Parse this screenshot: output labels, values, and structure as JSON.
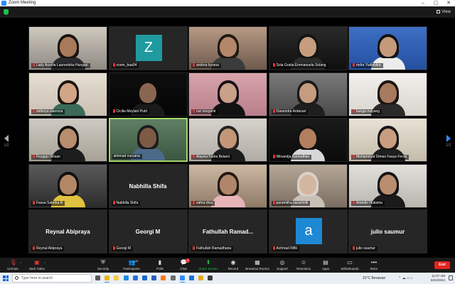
{
  "window": {
    "title": "Zoom Meeting",
    "view_label": "View"
  },
  "pagination": {
    "left": "1/2",
    "right": "1/2"
  },
  "participants": [
    {
      "name": "Lady Aurelia Laurentzka Hungari",
      "type": "video",
      "muted": true,
      "scene": [
        "#cfc9bf",
        "#8f8a82"
      ],
      "skin": "#a97a5a",
      "hair": "#1a1410",
      "shirt": "#2a2a2e"
    },
    {
      "name": "zoom_baa04",
      "type": "avatar",
      "letter": "Z",
      "avatar_color": "#1f9a9e",
      "muted": true
    },
    {
      "name": "andrea kyrana",
      "type": "video",
      "muted": true,
      "scene": [
        "#b79a84",
        "#6e5a4e"
      ],
      "skin": "#b5876a",
      "hair": "#201812",
      "shirt": "#3b3b3b"
    },
    {
      "name": "Sola Gratia Emmanuela Solang",
      "type": "video",
      "muted": true,
      "scene": [
        "#2b2b2b",
        "#0f0f0f"
      ],
      "skin": "#c79c7e",
      "hair": "#141414",
      "shirt": "#2b2b2b"
    },
    {
      "name": "mdra Yudhistira",
      "type": "video",
      "muted": true,
      "scene": [
        "#3d6fc4",
        "#2550a0"
      ],
      "skin": "#c49a7b",
      "hair": "#121212",
      "shirt": "#ececec"
    },
    {
      "name": "zefanya valencia",
      "type": "video",
      "muted": true,
      "scene": [
        "#e7dfd3",
        "#c9bfb2"
      ],
      "skin": "#d1a587",
      "hair": "#1b140f",
      "shirt": "#3b6b58"
    },
    {
      "name": "Cicilia Meylani Putri",
      "type": "video",
      "muted": true,
      "scene": [
        "#0e0e0e",
        "#050505"
      ],
      "skin": "#8a6650",
      "hair": "#0c0c0c",
      "shirt": "#1a1a1a"
    },
    {
      "name": "nur novyanti",
      "type": "video",
      "muted": true,
      "scene": [
        "#d8a4ac",
        "#b87f8a"
      ],
      "skin": "#c9a088",
      "hair": "#161016",
      "shirt": "#121212"
    },
    {
      "name": "Danendra Ardanari",
      "type": "video",
      "muted": true,
      "scene": [
        "#7a7a7a",
        "#4a4a4a"
      ],
      "skin": "#c59c7f",
      "hair": "#1a1a1a",
      "shirt": "#1e1e1e"
    },
    {
      "name": "bunga mayang",
      "type": "video",
      "muted": true,
      "scene": [
        "#f2f0ec",
        "#d9d5cf"
      ],
      "skin": "#a77a5e",
      "hair": "#1c1410",
      "shirt": "#2a2a2a"
    },
    {
      "name": "Feygigo Ikhsan",
      "type": "video",
      "muted": true,
      "scene": [
        "#cfcac2",
        "#a7a196"
      ],
      "skin": "#b88d6e",
      "hair": "#111111",
      "shirt": "#1d1d1d"
    },
    {
      "name": "akhmad nurcana",
      "type": "video",
      "muted": false,
      "active": true,
      "scene": [
        "#5f7f63",
        "#3b5641"
      ],
      "skin": "#7d5a44",
      "hair": "#1c1c1c",
      "shirt": "#4b6a8a"
    },
    {
      "name": "Alaysia Fatira Belami",
      "type": "video",
      "muted": true,
      "scene": [
        "#d6d2cc",
        "#b1aca5"
      ],
      "skin": "#c39678",
      "hair": "#222222",
      "shirt": "#1c1c1c"
    },
    {
      "name": "Winandja Ramadhan",
      "type": "video",
      "muted": true,
      "scene": [
        "#1b1b1b",
        "#0b0b0b"
      ],
      "skin": "#b27f5f",
      "hair": "#111111",
      "shirt": "#d7d7d7"
    },
    {
      "name": "Muhammad Dimas Fasya Ferari",
      "type": "video",
      "muted": true,
      "scene": [
        "#e9e2d6",
        "#c4bba9"
      ],
      "skin": "#c99e80",
      "hair": "#161616",
      "shirt": "#1f1f1f"
    },
    {
      "name": "Fassa Sabrina R",
      "type": "video",
      "muted": true,
      "scene": [
        "#5a5a5a",
        "#2c2c2c"
      ],
      "skin": "#b38666",
      "hair": "#0f0f0f",
      "shirt": "#e0c240"
    },
    {
      "name": "Nabhilla Shifa",
      "type": "namecard",
      "display": "Nabhilla Shifa",
      "muted": true
    },
    {
      "name": "zahra diva",
      "type": "video",
      "muted": true,
      "scene": [
        "#cdb8a3",
        "#8f7a66"
      ],
      "skin": "#b0866a",
      "hair": "#231a14",
      "shirt": "#e7b4b8"
    },
    {
      "name": "paramitha sarachelli",
      "type": "video",
      "muted": true,
      "scene": [
        "#b7a898",
        "#7b6d61"
      ],
      "skin": "#d4b6a0",
      "hair": "#d9d2cb",
      "shirt": "#c9c0b8"
    },
    {
      "name": "Amedio Hukama",
      "type": "video",
      "muted": true,
      "scene": [
        "#e2e0dc",
        "#b9b6b0"
      ],
      "skin": "#b98e70",
      "hair": "#141414",
      "shirt": "#1b1b1b"
    },
    {
      "name": "Reynal Abipraya",
      "type": "namecard",
      "display": "Reynal Abipraya",
      "muted": true
    },
    {
      "name": "Georgi M",
      "type": "namecard",
      "display": "Georgi M",
      "muted": true
    },
    {
      "name": "Fathullah Ramadhana",
      "type": "namecard",
      "display": "Fathullah  Ramad...",
      "muted": true
    },
    {
      "name": "Achmad Rifki",
      "type": "avatar",
      "letter": "a",
      "avatar_color": "#1e88d4",
      "muted": true
    },
    {
      "name": "julio saumur",
      "type": "namecard",
      "display": "julio saumur",
      "muted": true
    }
  ],
  "toolbar": {
    "unmute": "Unmute",
    "start_video": "Start Video",
    "security": "Security",
    "participants": "Participants",
    "participants_count": "40",
    "polls": "Polls",
    "chat": "Chat",
    "chat_badge": "1",
    "share_screen": "Share Screen",
    "record": "Record",
    "breakout_rooms": "Breakout Rooms",
    "support": "Support",
    "reactions": "Reactions",
    "apps": "Apps",
    "whiteboards": "Whiteboards",
    "more": "More",
    "end": "End",
    "share_color": "#1fbf4a",
    "end_color": "#e0241f"
  },
  "taskbar": {
    "search_placeholder": "Type here to search",
    "weather": "31°C  Berawan",
    "time": "11:07 AM",
    "date": "8/22/2022",
    "apps": [
      {
        "name": "task-view-icon",
        "color": "#555555"
      },
      {
        "name": "chrome-icon",
        "color": "#e8b70e"
      },
      {
        "name": "explorer-icon",
        "color": "#f3c94b"
      },
      {
        "name": "edge-icon",
        "color": "#1f8bd8"
      },
      {
        "name": "store-icon",
        "color": "#2b6fd6"
      },
      {
        "name": "mail-icon",
        "color": "#1e66c8"
      },
      {
        "name": "word-icon",
        "color": "#2b5fb8"
      },
      {
        "name": "firefox-icon",
        "color": "#ff7a1a"
      },
      {
        "name": "settings-icon",
        "color": "#6a6a6a"
      },
      {
        "name": "zoom-icon",
        "color": "#2d8cff"
      },
      {
        "name": "ie-icon",
        "color": "#1a73c9"
      },
      {
        "name": "folder-icon",
        "color": "#e6a81f"
      },
      {
        "name": "app-icon",
        "color": "#3b3b3b"
      }
    ]
  }
}
